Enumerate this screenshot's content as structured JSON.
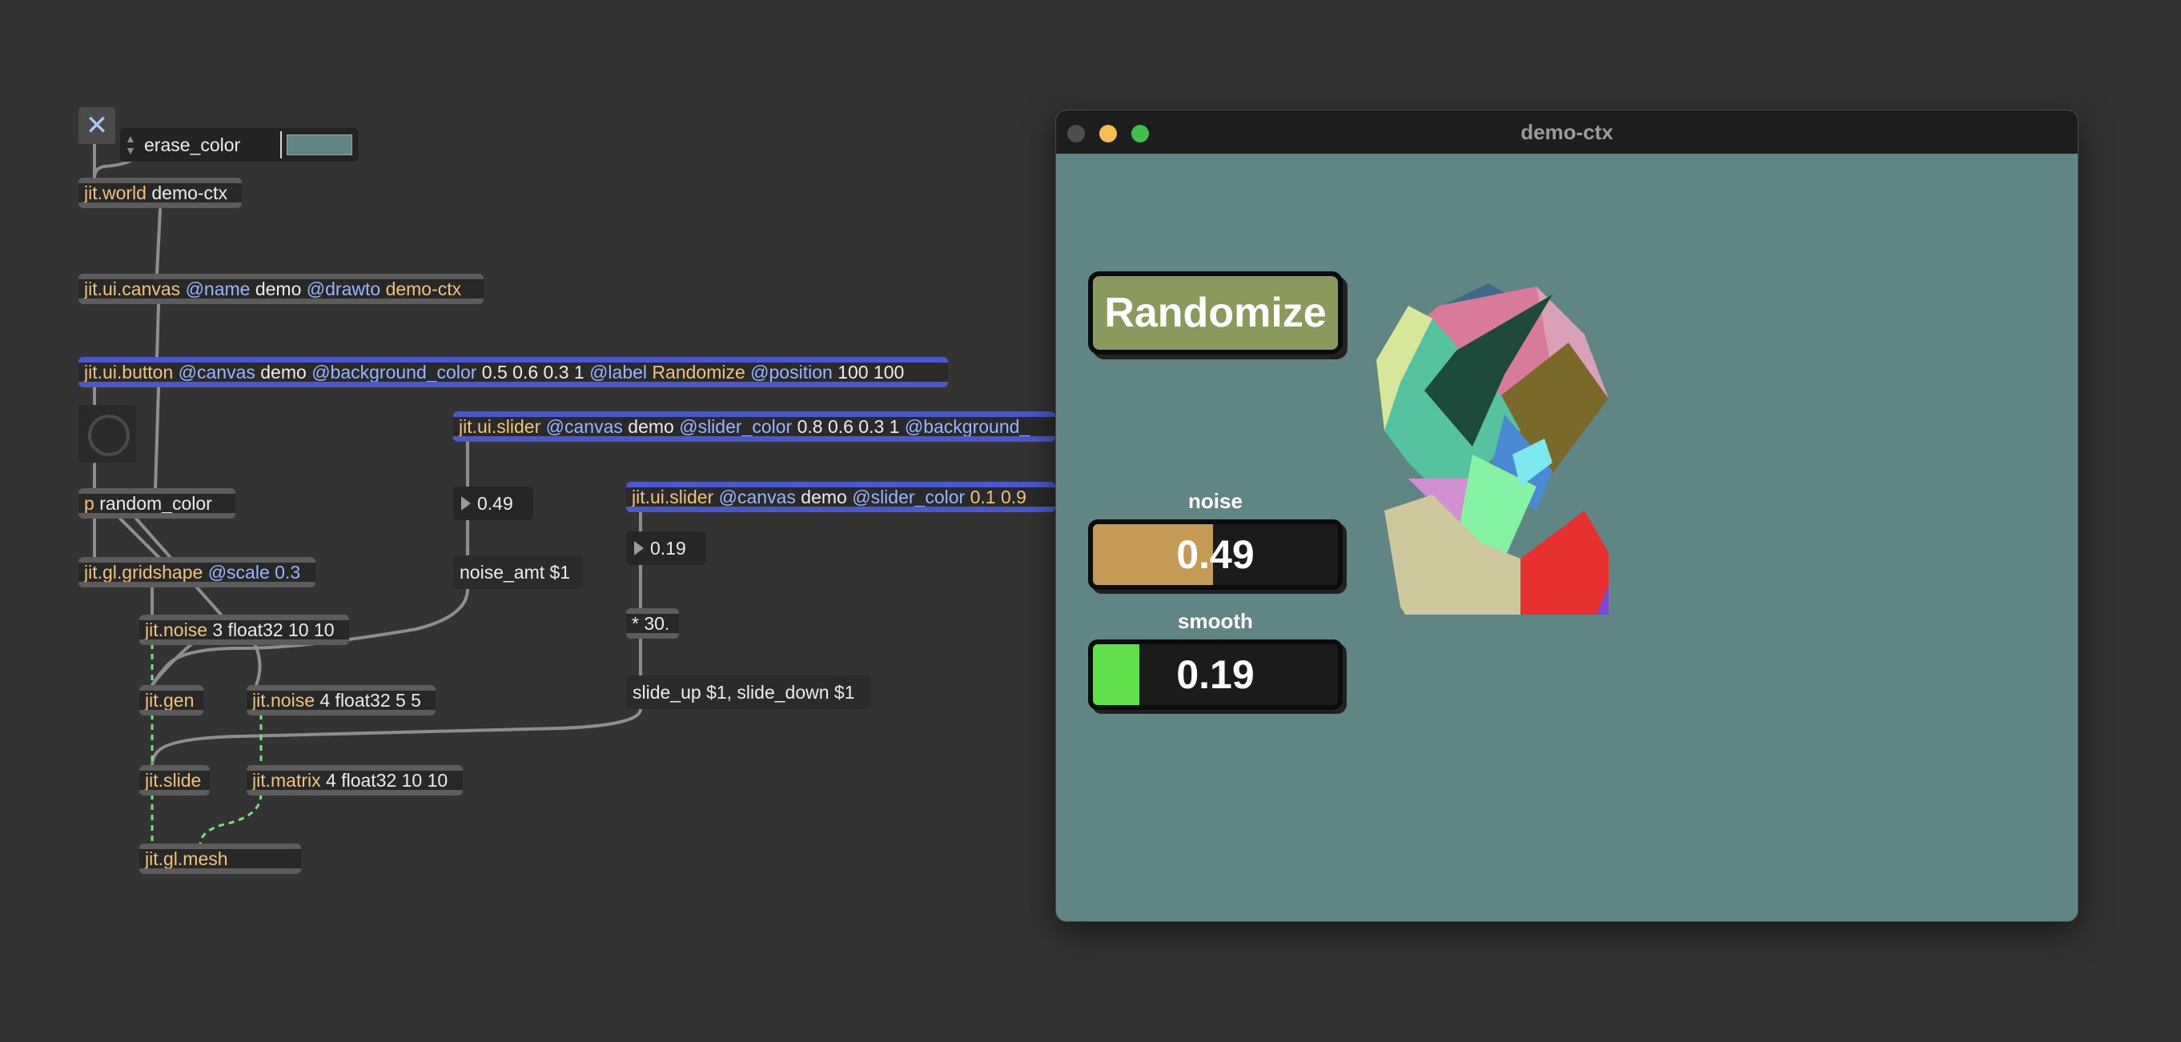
{
  "patcher": {
    "erase_color_msg": "erase_color",
    "swatch_color": "#5f8584",
    "objects": {
      "world": {
        "cls": "jit.world",
        "args": "demo-ctx"
      },
      "canvas": {
        "cls": "jit.ui.canvas",
        "a1": "@name",
        "v1": "demo",
        "a2": "@drawto",
        "v2": "demo-ctx"
      },
      "button": {
        "cls": "jit.ui.button",
        "a1": "@canvas",
        "v1": "demo",
        "a2": "@background_color",
        "v2": "0.5 0.6 0.3 1",
        "a3": "@label",
        "v3": "Randomize",
        "a4": "@position",
        "v4": "100 100"
      },
      "slider1": {
        "cls": "jit.ui.slider",
        "a1": "@canvas",
        "v1": "demo",
        "a2": "@slider_color",
        "v2": "0.8 0.6 0.3 1",
        "a3": "@background_"
      },
      "slider2": {
        "cls": "jit.ui.slider",
        "a1": "@canvas",
        "v1": "demo",
        "a2": "@slider_color",
        "v2": "0.1 0.9"
      },
      "random_color": {
        "cls": "p",
        "args": "random_color"
      },
      "gridshape": {
        "cls": "jit.gl.gridshape",
        "a1": "@scale",
        "v1": "0.3"
      },
      "noise1": {
        "cls": "jit.noise",
        "args": "3 float32 10 10"
      },
      "gen": {
        "cls": "jit.gen"
      },
      "noise2": {
        "cls": "jit.noise",
        "args": "4 float32 5 5"
      },
      "slide": {
        "cls": "jit.slide"
      },
      "matrix": {
        "cls": "jit.matrix",
        "args": "4 float32 10 10"
      },
      "mesh": {
        "cls": "jit.gl.mesh"
      },
      "times": {
        "cls": "*",
        "args": "30."
      }
    },
    "number1": "0.49",
    "number2": "0.19",
    "msg_noise_amt": "noise_amt $1",
    "msg_slide": "slide_up $1, slide_down $1"
  },
  "window": {
    "title": "demo-ctx",
    "background": "#5f8584",
    "randomize_label": "Randomize",
    "noise": {
      "label": "noise",
      "value_text": "0.49",
      "value": 0.49,
      "fill": "#c49a55"
    },
    "smooth": {
      "label": "smooth",
      "value_text": "0.19",
      "value": 0.19,
      "fill": "#62e04c"
    }
  }
}
